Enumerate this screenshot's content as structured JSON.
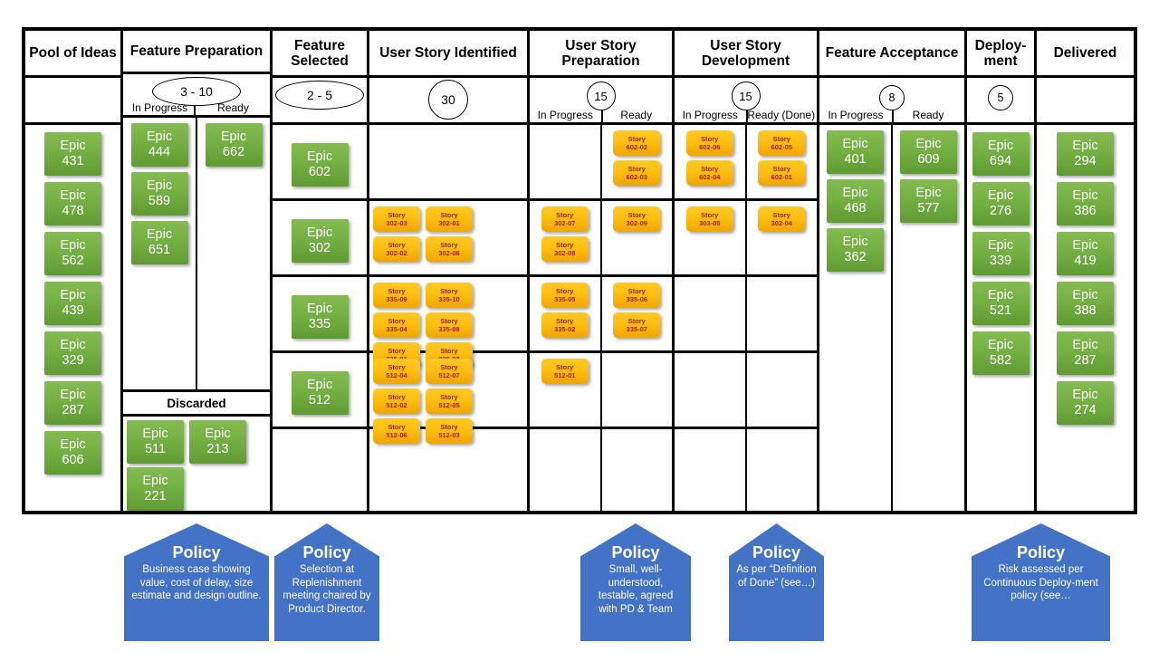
{
  "board": {
    "columns": [
      {
        "id": "pool-of-ideas",
        "title": "Pool of Ideas",
        "wip": null,
        "sub_columns": [],
        "cards": [
          "Epic 431",
          "Epic 478",
          "Epic 562",
          "Epic 439",
          "Epic 329",
          "Epic 287",
          "Epic 606"
        ]
      },
      {
        "id": "feature-preparation",
        "title": "Feature Preparation",
        "wip": "3 - 10",
        "wip_shape": "ellipse",
        "sub_columns": [
          "In Progress",
          "Ready"
        ],
        "in_progress": [
          "Epic 444",
          "Epic 589",
          "Epic 651"
        ],
        "ready": [
          "Epic 662"
        ],
        "discarded_label": "Discarded",
        "discarded": [
          "Epic 511",
          "Epic 213",
          "Epic 221"
        ]
      },
      {
        "id": "feature-selected",
        "title": "Feature Selected",
        "wip": "2 - 5",
        "wip_shape": "ellipse",
        "sub_columns": []
      },
      {
        "id": "user-story-identified",
        "title": "User Story Identified",
        "wip": "30",
        "wip_shape": "circle",
        "sub_columns": []
      },
      {
        "id": "user-story-preparation",
        "title": "User Story Preparation",
        "wip": "15",
        "wip_shape": "circle-md",
        "sub_columns": [
          "In Progress",
          "Ready"
        ]
      },
      {
        "id": "user-story-development",
        "title": "User Story Development",
        "wip": "15",
        "wip_shape": "circle-md",
        "sub_columns": [
          "In Progress",
          "Ready (Done)"
        ]
      },
      {
        "id": "feature-acceptance",
        "title": "Feature Acceptance",
        "wip": "8",
        "wip_shape": "circle-sm",
        "sub_columns": [
          "In Progress",
          "Ready"
        ],
        "in_progress": [
          "Epic 401",
          "Epic 468",
          "Epic 362"
        ],
        "ready": [
          "Epic 609",
          "Epic 577"
        ]
      },
      {
        "id": "deployment",
        "title": "Deploy- ment",
        "title_line1": "Deploy-",
        "title_line2": "ment",
        "wip": "5",
        "wip_shape": "circle-sm",
        "sub_columns": [],
        "cards": [
          "Epic 694",
          "Epic 276",
          "Epic 339",
          "Epic 521",
          "Epic 582"
        ]
      },
      {
        "id": "delivered",
        "title": "Delivered",
        "wip": null,
        "sub_columns": [],
        "cards": [
          "Epic 294",
          "Epic 386",
          "Epic 419",
          "Epic 388",
          "Epic 287",
          "Epic 274"
        ]
      }
    ],
    "swimlanes": [
      {
        "epic": "Epic 602",
        "identified": [],
        "prep_in_progress": [],
        "prep_ready": [
          "Story 602-02",
          "Story 602-03"
        ],
        "dev_in_progress": [
          "Story 602-06",
          "Story 602-04"
        ],
        "dev_ready": [
          "Story 602-05",
          "Story 602-01"
        ]
      },
      {
        "epic": "Epic 302",
        "identified": [
          "Story 302-03",
          "Story 302-01",
          "Story 302-02",
          "Story 302-06"
        ],
        "prep_in_progress": [
          "Story 302-07",
          "Story 302-08"
        ],
        "prep_ready": [
          "Story 302-09"
        ],
        "dev_in_progress": [
          "Story 303-05"
        ],
        "dev_ready": [
          "Story 302-04"
        ]
      },
      {
        "epic": "Epic 335",
        "identified": [
          "Story 335-09",
          "Story 335-10",
          "Story 335-04",
          "Story 335-08",
          "Story 335-01",
          "Story 335-03"
        ],
        "prep_in_progress": [
          "Story 335-05",
          "Story 335-02"
        ],
        "prep_ready": [
          "Story 335-06",
          "Story 335-07"
        ],
        "dev_in_progress": [],
        "dev_ready": []
      },
      {
        "epic": "Epic 512",
        "identified": [
          "Story 512-04",
          "Story 512-07",
          "Story 512-02",
          "Story 512-05",
          "Story 512-06",
          "Story 512-03"
        ],
        "prep_in_progress": [
          "Story 512-01"
        ],
        "prep_ready": [],
        "dev_in_progress": [],
        "dev_ready": []
      },
      {
        "epic": "",
        "identified": [],
        "prep_in_progress": [],
        "prep_ready": [],
        "dev_in_progress": [],
        "dev_ready": []
      }
    ]
  },
  "policies": [
    {
      "id": "policy-feature-preparation",
      "title": "Policy",
      "text": "Business case showing value, cost of delay, size estimate and design outline."
    },
    {
      "id": "policy-feature-selected",
      "title": "Policy",
      "text": "Selection at Replenishment meeting chaired by Product Director."
    },
    {
      "id": "policy-user-story-preparation",
      "title": "Policy",
      "text": "Small, well-understood, testable, agreed with PD & Team"
    },
    {
      "id": "policy-user-story-development",
      "title": "Policy",
      "text": "As per “Definition of Done” (see…)"
    },
    {
      "id": "policy-deployment",
      "title": "Policy",
      "text": "Risk assessed per Continuous Deploy-ment policy (see…"
    }
  ],
  "colors": {
    "epic_card": "#74b043",
    "story_card": "#ffbf11",
    "story_text": "#a32020",
    "policy": "#4472c4",
    "border": "#000000"
  }
}
